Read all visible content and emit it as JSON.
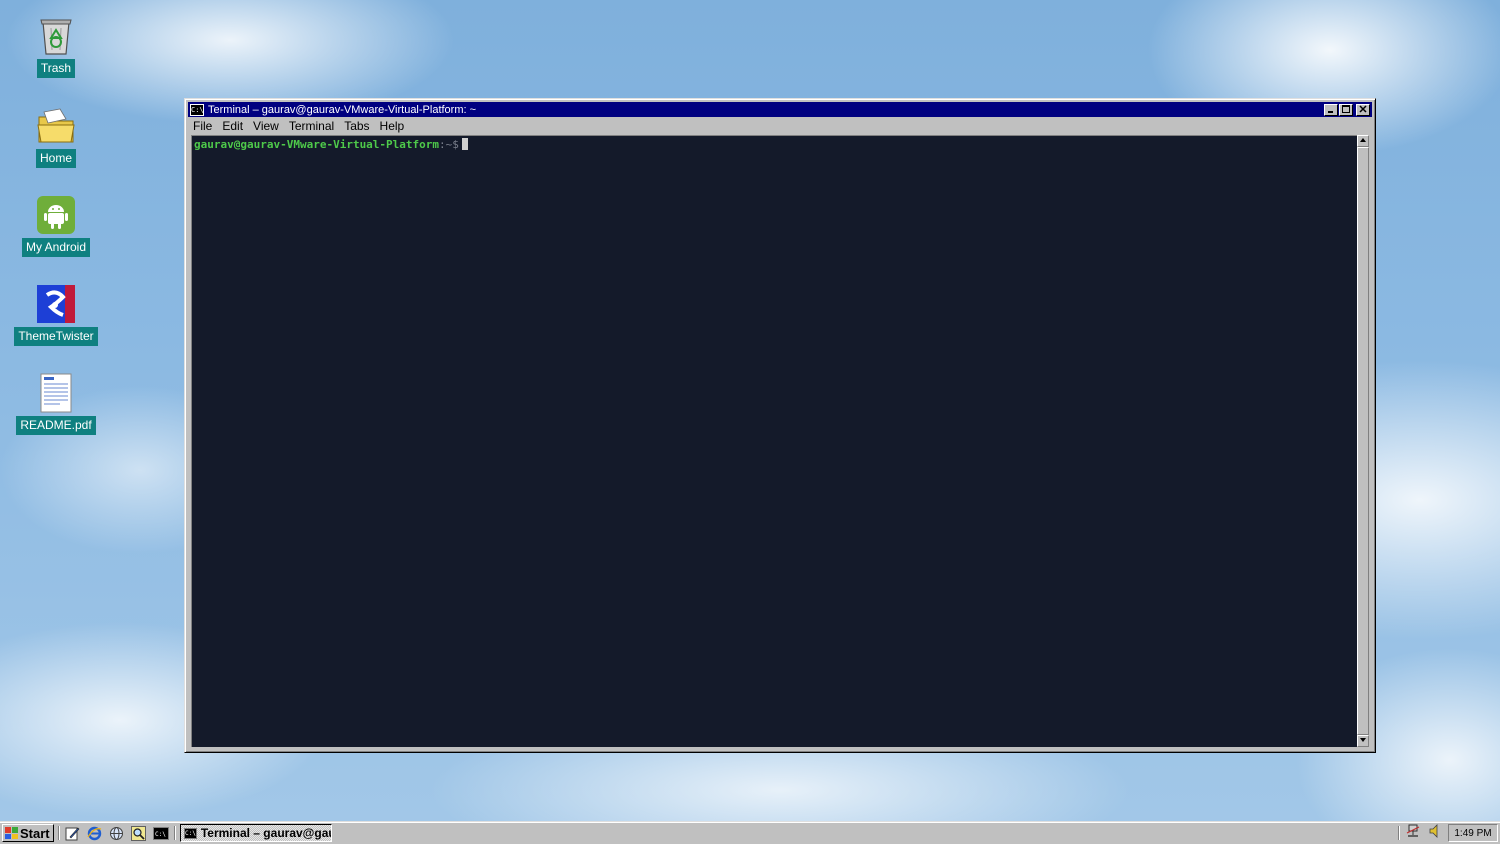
{
  "desktop": {
    "icons": [
      {
        "label": "Trash",
        "icon": "trash-icon"
      },
      {
        "label": "Home",
        "icon": "folder-icon"
      },
      {
        "label": "My Android",
        "icon": "android-icon"
      },
      {
        "label": "ThemeTwister",
        "icon": "themetwister-icon"
      },
      {
        "label": "README.pdf",
        "icon": "document-icon"
      }
    ]
  },
  "window": {
    "title": "Terminal – gaurav@gaurav-VMware-Virtual-Platform: ~",
    "menu": [
      "File",
      "Edit",
      "View",
      "Terminal",
      "Tabs",
      "Help"
    ],
    "prompt_user": "gaurav@gaurav-VMware-Virtual-Platform",
    "prompt_path": ":~$",
    "colors": {
      "background": "#141a2a",
      "prompt": "#4ec94a",
      "titlebar": "#000080"
    }
  },
  "taskbar": {
    "start_label": "Start",
    "task_label": "Terminal – gaurav@gau...",
    "clock": "1:49 PM"
  }
}
